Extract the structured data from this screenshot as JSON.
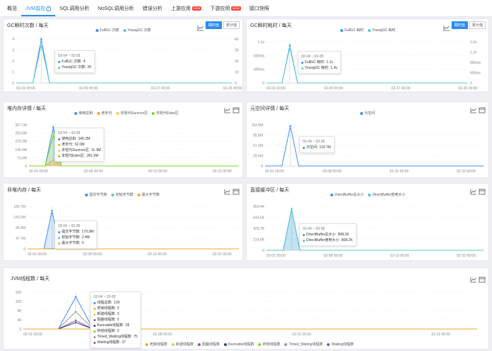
{
  "tabs": [
    {
      "label": "概览",
      "active": false
    },
    {
      "label": "JVM监控",
      "active": true,
      "help": "?"
    },
    {
      "label": "SQL调用分析",
      "active": false
    },
    {
      "label": "NoSQL调用分析",
      "active": false
    },
    {
      "label": "错误分析",
      "active": false
    },
    {
      "label": "上游应用",
      "active": false,
      "badge": "NEW"
    },
    {
      "label": "下游应用",
      "active": false,
      "badge": "NEW"
    },
    {
      "label": "接口快照",
      "active": false
    }
  ],
  "buttons": {
    "instant": "瞬时值",
    "cumulative": "累计值"
  },
  "colors": {
    "blue": "#3e8ef7",
    "teal": "#5ac8c8",
    "orange": "#f5a623",
    "gold": "#f7c94d",
    "green": "#7ed321",
    "purple": "#8b5a9e",
    "navy": "#34428c",
    "gray": "#999999"
  },
  "panels": {
    "gcCount": {
      "title": "GC瞬时次数 / 每天",
      "legend": [
        {
          "name": "FullGC 次数",
          "color": "#3e8ef7"
        },
        {
          "name": "YoungGC 次数",
          "color": "#5ac8c8"
        }
      ],
      "tooltip": {
        "header": "02-04 ~ 02-05",
        "rows": [
          {
            "label": "FullGC 次数:",
            "value": "4",
            "color": "#3e8ef7"
          },
          {
            "label": "YoungGC 次数:",
            "value": "35",
            "color": "#5ac8c8"
          }
        ]
      }
    },
    "gcTime": {
      "title": "GC瞬时耗时 / 每天",
      "legend": [
        {
          "name": "FullGC 耗时",
          "color": "#3e8ef7"
        },
        {
          "name": "YoungGC 耗时",
          "color": "#5ac8c8"
        }
      ],
      "tooltip": {
        "header": "02-04 ~ 02-05",
        "rows": [
          {
            "label": "FullGC 耗时:",
            "value": "1.1s",
            "color": "#3e8ef7"
          },
          {
            "label": "YoungGC 耗时:",
            "value": "1.4s",
            "color": "#5ac8c8"
          }
        ]
      }
    },
    "heap": {
      "title": "堆内存详情 / 每天",
      "legend": [
        {
          "name": "使用总和",
          "color": "#3e8ef7"
        },
        {
          "name": "老年代",
          "color": "#f5a623"
        },
        {
          "name": "年轻代Survivor区",
          "color": "#f7c94d"
        },
        {
          "name": "年轻代Eden区",
          "color": "#7ed321"
        }
      ],
      "tooltip": {
        "header": "02-04 ~ 02-05",
        "rows": [
          {
            "label": "使用总和:",
            "value": "345.2M",
            "color": "#3e8ef7"
          },
          {
            "label": "老年代:",
            "value": "52.0M",
            "color": "#f5a623"
          },
          {
            "label": "年轻代Survivor区:",
            "value": "11.3M",
            "color": "#f7c94d"
          },
          {
            "label": "年轻代Eden区:",
            "value": "281.9M",
            "color": "#7ed321"
          }
        ]
      }
    },
    "metaspace": {
      "title": "元空间详情 / 每天",
      "legend": [
        {
          "name": "元空间",
          "color": "#3e8ef7"
        }
      ],
      "tooltip": {
        "header": "02-04 ~ 02-05",
        "rows": [
          {
            "label": "元空间:",
            "value": "110.7M",
            "color": "#3e8ef7"
          }
        ]
      }
    },
    "nonheap": {
      "title": "非堆内存 / 每天",
      "legend": [
        {
          "name": "提交字节数",
          "color": "#3e8ef7"
        },
        {
          "name": "初始字节数",
          "color": "#5ac8c8"
        },
        {
          "name": "最大字节数",
          "color": "#f5a623"
        }
      ],
      "tooltip": {
        "header": "02-04 ~ 02-05",
        "rows": [
          {
            "label": "提交字节数:",
            "value": "170.9M",
            "color": "#3e8ef7"
          },
          {
            "label": "初始字节数:",
            "value": "2.4M",
            "color": "#5ac8c8"
          },
          {
            "label": "最大字节数:",
            "value": "0",
            "color": "#f5a623"
          }
        ]
      }
    },
    "direct": {
      "title": "直接缓冲区 / 每天",
      "legend": [
        {
          "name": "DirectBuffer总大小",
          "color": "#3e8ef7"
        },
        {
          "name": "DirectBuffer使用大小",
          "color": "#5ac8c8"
        }
      ],
      "tooltip": {
        "header": "02-04 ~ 02-05",
        "rows": [
          {
            "label": "DirectBuffer总大小:",
            "value": "808.2K",
            "color": "#3e8ef7"
          },
          {
            "label": "DirectBuffer使用大小:",
            "value": "808.2K",
            "color": "#5ac8c8"
          }
        ]
      }
    },
    "threads": {
      "title": "JVM线程数 / 每天",
      "legend": [
        {
          "name": "死锁线程数",
          "color": "#f5a623"
        },
        {
          "name": "新建线程数",
          "color": "#f7c94d"
        },
        {
          "name": "阻塞线程数",
          "color": "#8b5a9e"
        },
        {
          "name": "Runnable线程数",
          "color": "#34428c"
        },
        {
          "name": "终结线程数",
          "color": "#7ed321"
        },
        {
          "name": "Timed_Waiting线程数",
          "color": "#999999"
        },
        {
          "name": "Waiting线程数",
          "color": "#8b5a9e"
        }
      ],
      "tooltip": {
        "header": "02-04 ~ 02-05",
        "rows": [
          {
            "label": "线程总数:",
            "value": "139",
            "color": "#3e8ef7"
          },
          {
            "label": "死锁线程数:",
            "value": "0",
            "color": "#f5a623"
          },
          {
            "label": "新建线程数:",
            "value": "0",
            "color": "#f7c94d"
          },
          {
            "label": "阻塞线程数:",
            "value": "0",
            "color": "#8b5a9e"
          },
          {
            "label": "Runnable线程数:",
            "value": "28",
            "color": "#34428c"
          },
          {
            "label": "终结线程数:",
            "value": "0",
            "color": "#7ed321"
          },
          {
            "label": "Timed_Waiting线程数:",
            "value": "75",
            "color": "#999999"
          },
          {
            "label": "Waiting线程数:",
            "value": "37",
            "color": "#8b5a9e"
          }
        ]
      }
    }
  },
  "chart_data": [
    {
      "id": "gcCount",
      "type": "line",
      "x": [
        "02-01 00:00",
        "02-09 00:00",
        "02-17 00:00",
        "02-26 00:00"
      ],
      "yTicks": [
        "0",
        "1",
        "2",
        "3",
        "4"
      ],
      "y2Ticks": [
        "0",
        "10",
        "20",
        "30",
        "40"
      ],
      "ylim": [
        0,
        4
      ],
      "y2lim": [
        0,
        40
      ],
      "series": [
        {
          "name": "FullGC 次数",
          "axis": "left",
          "points": [
            [
              0,
              0
            ],
            [
              2,
              0
            ],
            [
              3,
              4
            ],
            [
              4,
              0
            ],
            [
              26,
              0
            ]
          ]
        },
        {
          "name": "YoungGC 次数",
          "axis": "right",
          "points": [
            [
              0,
              0
            ],
            [
              2,
              0
            ],
            [
              3,
              35
            ],
            [
              4,
              0
            ],
            [
              26,
              0
            ]
          ]
        }
      ]
    },
    {
      "id": "gcTime",
      "type": "line",
      "x": [
        "02-01 00:00",
        "02-09 00:00",
        "02-17 00:00",
        "02-26 00:00"
      ],
      "yTicks": [
        "0",
        "400ms",
        "800ms",
        "1.2s"
      ],
      "y2Ticks": [
        "0",
        "400ms",
        "800ms",
        "1.2s",
        "1.6s"
      ],
      "ylim": [
        0,
        1.2
      ],
      "y2lim": [
        0,
        1.6
      ],
      "series": [
        {
          "name": "FullGC 耗时",
          "axis": "left",
          "points": [
            [
              0,
              0
            ],
            [
              2,
              0
            ],
            [
              3,
              1.1
            ],
            [
              4,
              0
            ],
            [
              26,
              0
            ]
          ]
        },
        {
          "name": "YoungGC 耗时",
          "axis": "right",
          "points": [
            [
              0,
              0
            ],
            [
              2,
              0
            ],
            [
              3,
              1.4
            ],
            [
              4,
              0
            ],
            [
              26,
              0
            ]
          ]
        }
      ]
    },
    {
      "id": "heap",
      "type": "area",
      "x": [
        "02-01 00:00",
        "02-08 00:00",
        "02-15 00:00",
        "02-22 00:00"
      ],
      "yTicks": [
        "0",
        "73.4M",
        "146.9M",
        "220.3M",
        "293.6M",
        "367.1M"
      ],
      "ylim": [
        0,
        367.1
      ],
      "series": [
        {
          "name": "使用总和",
          "points": [
            [
              0,
              0
            ],
            [
              2,
              0
            ],
            [
              3,
              345.2
            ],
            [
              4,
              0
            ],
            [
              26,
              0
            ]
          ]
        },
        {
          "name": "老年代",
          "points": [
            [
              0,
              0
            ],
            [
              2,
              0
            ],
            [
              3,
              52.0
            ],
            [
              4,
              0
            ],
            [
              26,
              0
            ]
          ]
        },
        {
          "name": "年轻代Survivor区",
          "points": [
            [
              0,
              0
            ],
            [
              2,
              0
            ],
            [
              3,
              11.3
            ],
            [
              4,
              0
            ],
            [
              26,
              0
            ]
          ]
        },
        {
          "name": "年轻代Eden区",
          "points": [
            [
              0,
              0
            ],
            [
              2,
              0
            ],
            [
              3,
              281.9
            ],
            [
              4,
              0
            ],
            [
              26,
              0
            ]
          ]
        }
      ]
    },
    {
      "id": "metaspace",
      "type": "line",
      "x": [
        "02-01 00:00",
        "02-08 00:00",
        "02-15 00:00",
        "02-22 00:00"
      ],
      "yTicks": [
        "0",
        "28.6M",
        "57.2M",
        "85.8M",
        "114.4M"
      ],
      "ylim": [
        0,
        114.4
      ],
      "series": [
        {
          "name": "元空间",
          "points": [
            [
              0,
              0
            ],
            [
              2,
              0
            ],
            [
              3,
              110.7
            ],
            [
              4,
              0
            ],
            [
              26,
              0
            ]
          ]
        }
      ]
    },
    {
      "id": "nonheap",
      "type": "area",
      "x": [
        "02-01 00:00",
        "02-08 00:00",
        "02-15 00:00",
        "02-22 00:00"
      ],
      "yTicks": [
        "0",
        "47.7M",
        "95.4M",
        "143.0M",
        "190.7M"
      ],
      "ylim": [
        0,
        190.7
      ],
      "series": [
        {
          "name": "提交字节数",
          "points": [
            [
              0,
              0
            ],
            [
              2,
              0
            ],
            [
              3,
              170.9
            ],
            [
              4,
              0
            ],
            [
              26,
              0
            ]
          ]
        },
        {
          "name": "初始字节数",
          "points": [
            [
              0,
              0
            ],
            [
              2,
              0
            ],
            [
              3,
              2.4
            ],
            [
              4,
              0
            ],
            [
              26,
              0
            ]
          ]
        },
        {
          "name": "最大字节数",
          "points": [
            [
              0,
              0
            ],
            [
              26,
              0
            ]
          ]
        }
      ]
    },
    {
      "id": "direct",
      "type": "area",
      "x": [
        "02-01 00:00",
        "02-08 00:00",
        "02-15 00:00",
        "02-22 00:00"
      ],
      "yTicks": [
        "0",
        "214.8K",
        "429.7K",
        "644.5K",
        "859.4K"
      ],
      "ylim": [
        0,
        859.4
      ],
      "series": [
        {
          "name": "DirectBuffer总大小",
          "points": [
            [
              0,
              0
            ],
            [
              2,
              0
            ],
            [
              3,
              808.2
            ],
            [
              4,
              0
            ],
            [
              26,
              0
            ]
          ]
        },
        {
          "name": "DirectBuffer使用大小",
          "points": [
            [
              0,
              0
            ],
            [
              2,
              0
            ],
            [
              3,
              808.2
            ],
            [
              4,
              0
            ],
            [
              26,
              0
            ]
          ]
        }
      ]
    },
    {
      "id": "threads",
      "type": "line",
      "x": [
        "02-01 00:00",
        "02-08 00:00",
        "02-15 00:00",
        "02-22 00:00"
      ],
      "yTicks": [
        "0",
        "40",
        "80",
        "120",
        "160"
      ],
      "ylim": [
        0,
        160
      ],
      "series": [
        {
          "name": "线程总数",
          "points": [
            [
              0,
              0
            ],
            [
              2,
              0
            ],
            [
              3,
              139
            ],
            [
              4,
              0
            ],
            [
              26,
              0
            ]
          ]
        },
        {
          "name": "Timed_Waiting线程数",
          "points": [
            [
              0,
              0
            ],
            [
              2,
              0
            ],
            [
              3,
              75
            ],
            [
              4,
              0
            ],
            [
              26,
              0
            ]
          ]
        },
        {
          "name": "Waiting线程数",
          "points": [
            [
              0,
              0
            ],
            [
              2,
              0
            ],
            [
              3,
              37
            ],
            [
              4,
              0
            ],
            [
              26,
              0
            ]
          ]
        },
        {
          "name": "Runnable线程数",
          "points": [
            [
              0,
              0
            ],
            [
              2,
              0
            ],
            [
              3,
              28
            ],
            [
              4,
              0
            ],
            [
              26,
              0
            ]
          ]
        },
        {
          "name": "死锁线程数",
          "points": [
            [
              0,
              0
            ],
            [
              26,
              0
            ]
          ]
        }
      ]
    }
  ]
}
